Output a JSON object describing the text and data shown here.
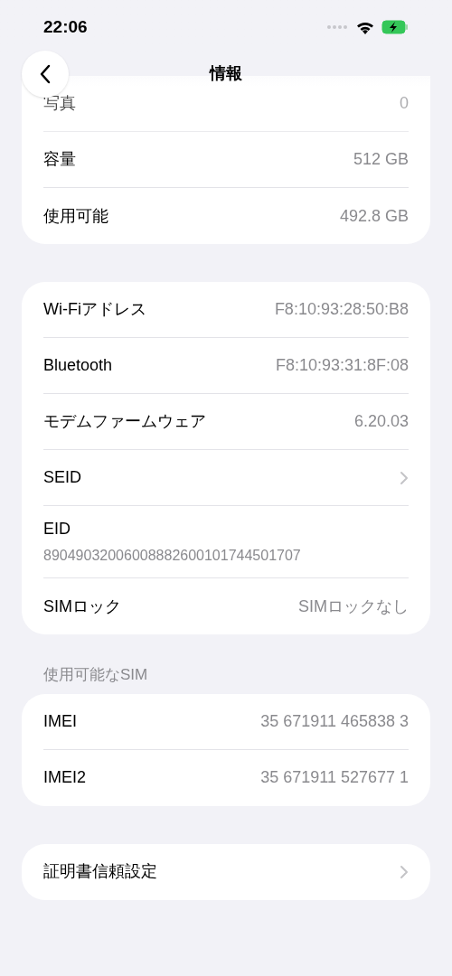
{
  "status_bar": {
    "time": "22:06"
  },
  "nav": {
    "title": "情報"
  },
  "groups": [
    {
      "rows": [
        {
          "kind": "value",
          "label": "写真",
          "value": "0",
          "dimmed": true
        },
        {
          "kind": "value",
          "label": "容量",
          "value": "512 GB",
          "dimmed": false
        },
        {
          "kind": "value",
          "label": "使用可能",
          "value": "492.8 GB",
          "dimmed": false
        }
      ]
    },
    {
      "rows": [
        {
          "kind": "value",
          "label": "Wi-Fiアドレス",
          "value": "F8:10:93:28:50:B8",
          "dimmed": false
        },
        {
          "kind": "value",
          "label": "Bluetooth",
          "value": "F8:10:93:31:8F:08",
          "dimmed": false
        },
        {
          "kind": "value",
          "label": "モデムファームウェア",
          "value": "6.20.03",
          "dimmed": false
        },
        {
          "kind": "chevron",
          "label": "SEID",
          "dimmed": false
        },
        {
          "kind": "stacked",
          "label": "EID",
          "value": "89049032006008882600101744501707",
          "dimmed": false
        },
        {
          "kind": "value",
          "label": "SIMロック",
          "value": "SIMロックなし",
          "dimmed": false
        }
      ]
    },
    {
      "header": "使用可能なSIM",
      "rows": [
        {
          "kind": "value",
          "label": "IMEI",
          "value": "35 671911 465838 3",
          "dimmed": false
        },
        {
          "kind": "value",
          "label": "IMEI2",
          "value": "35 671911 527677 1",
          "dimmed": false
        }
      ]
    },
    {
      "rows": [
        {
          "kind": "chevron",
          "label": "証明書信頼設定",
          "dimmed": false
        }
      ]
    }
  ]
}
